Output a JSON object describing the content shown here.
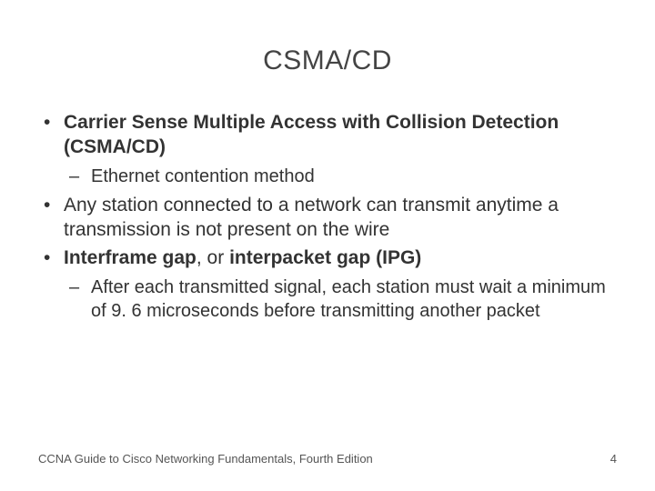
{
  "title": "CSMA/CD",
  "bullets": [
    {
      "text": "Carrier Sense Multiple Access with Collision Detection (CSMA/CD)",
      "bold": true,
      "sub": [
        {
          "text": "Ethernet contention method"
        }
      ]
    },
    {
      "text": "Any station connected to a network can transmit anytime a transmission is not present on the wire",
      "bold": false
    },
    {
      "text_before": "Interframe gap",
      "text_mid": ", or ",
      "text_after": "interpacket gap (IPG)",
      "bold_mixed": true,
      "sub": [
        {
          "text": "After each transmitted signal, each station must wait a minimum of 9. 6 microseconds before transmitting another packet"
        }
      ]
    }
  ],
  "footer": {
    "left": "CCNA Guide to Cisco Networking Fundamentals, Fourth Edition",
    "right": "4"
  }
}
